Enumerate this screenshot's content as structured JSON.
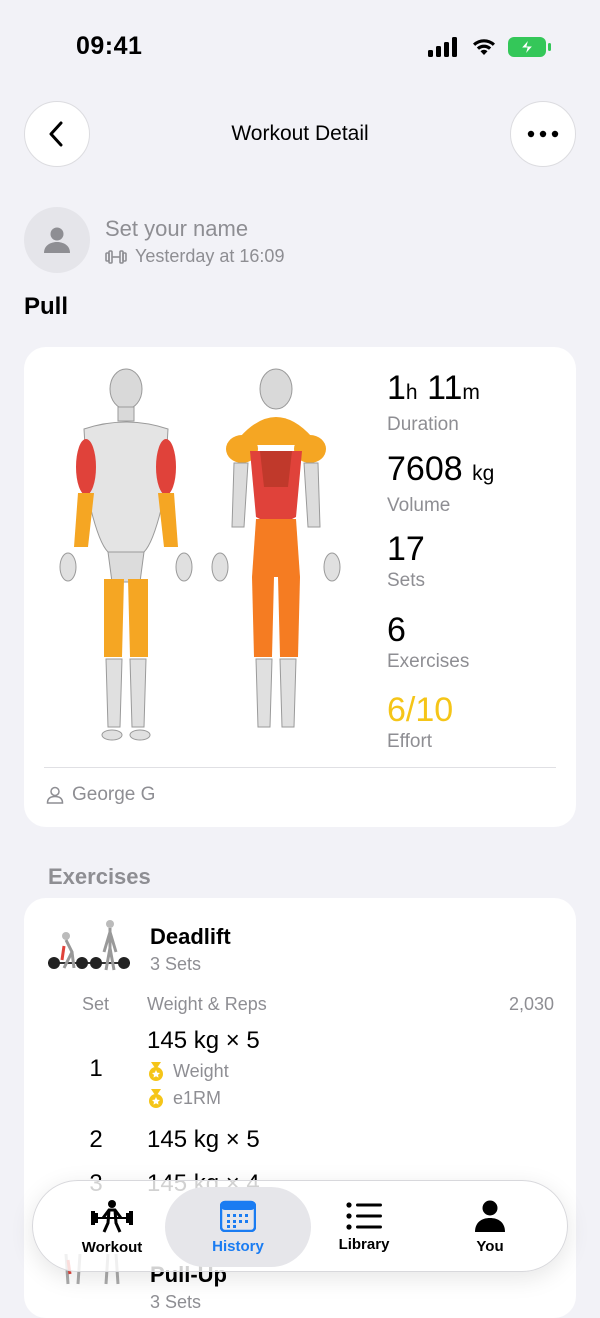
{
  "status_bar": {
    "time": "09:41"
  },
  "nav": {
    "title": "Workout Detail"
  },
  "user": {
    "name_placeholder": "Set your name",
    "timestamp": "Yesterday at 16:09"
  },
  "workout": {
    "title": "Pull"
  },
  "summary": {
    "duration_hours": "1",
    "duration_h_unit": "h",
    "duration_minutes": "11",
    "duration_m_unit": "m",
    "duration_label": "Duration",
    "volume_value": "7608",
    "volume_unit": "kg",
    "volume_label": "Volume",
    "sets_value": "17",
    "sets_label": "Sets",
    "exercises_value": "6",
    "exercises_label": "Exercises",
    "effort_value": "6/10",
    "effort_label": "Effort",
    "owner": "George G"
  },
  "exercises_section": {
    "title": "Exercises"
  },
  "exercise": {
    "name": "Deadlift",
    "sets_summary": "3 Sets",
    "col_set": "Set",
    "col_weight_reps": "Weight & Reps",
    "col_total": "2,030",
    "sets": [
      {
        "num": "1",
        "value": "145 kg × 5",
        "pr_weight": "Weight",
        "pr_e1rm": "e1RM"
      },
      {
        "num": "2",
        "value": "145 kg × 5"
      },
      {
        "num": "3",
        "value": "145 kg × 4"
      }
    ]
  },
  "next_exercise": {
    "name": "Pull-Up",
    "sets_summary": "3 Sets"
  },
  "tabbar": {
    "tabs": [
      {
        "label": "Workout",
        "icon": "workout-figure-icon"
      },
      {
        "label": "History",
        "icon": "calendar-icon"
      },
      {
        "label": "Library",
        "icon": "list-icon"
      },
      {
        "label": "You",
        "icon": "person-icon"
      }
    ],
    "active_tab": "History"
  },
  "colors": {
    "accent": "#1a7cf2",
    "effort": "#f5c518",
    "muscle_primary": "#e0423a",
    "muscle_secondary": "#f5a623"
  }
}
